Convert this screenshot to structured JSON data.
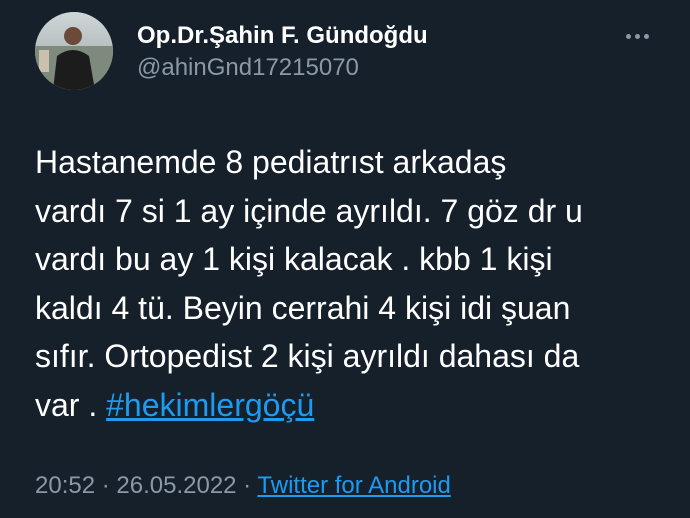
{
  "author": {
    "display_name": "Op.Dr.Şahin F. Gündoğdu",
    "handle": "@ahinGnd17215070",
    "avatar_icon": "profile-photo"
  },
  "tweet": {
    "text": "Hastanemde 8 pediatrıst arkadaş\nvardı 7 si 1 ay içinde ayrıldı. 7 göz dr u\nvardı bu ay 1 kişi kalacak . kbb 1 kişi\nkaldı 4 tü. Beyin cerrahi 4 kişi idi şuan\nsıfır. Ortopedist 2 kişi ayrıldı dahası da\nvar . ",
    "hashtag": "#hekimlergöçü"
  },
  "meta": {
    "time": "20:52",
    "separator1": " · ",
    "date": "26.05.2022",
    "separator2": " · ",
    "source": "Twitter for Android"
  },
  "colors": {
    "background": "#15202b",
    "link": "#1d9bf0",
    "secondary_text": "#8b98a5"
  }
}
